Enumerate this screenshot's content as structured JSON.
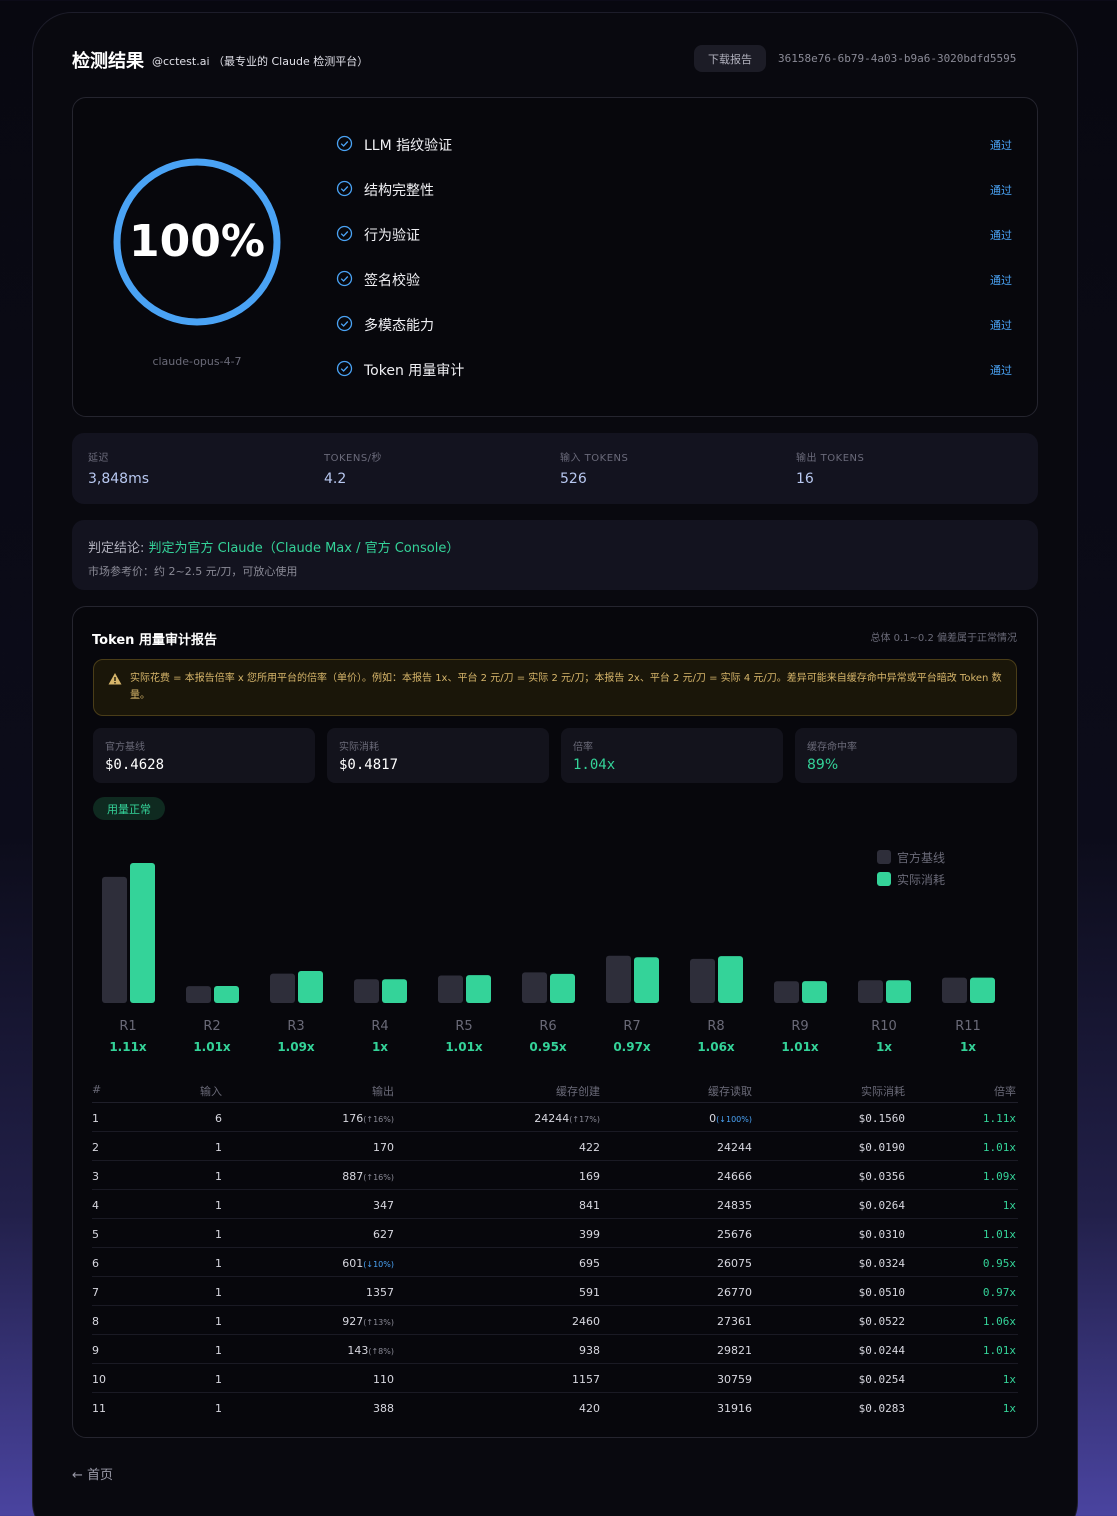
{
  "header": {
    "title": "检测结果",
    "subtitle": "@cctest.ai （最专业的 Claude 检测平台）",
    "download_label": "下载报告",
    "report_id": "36158e76-6b79-4a03-b9a6-3020bdfd5595"
  },
  "score": {
    "percent_text": "100%",
    "percent_value": 100,
    "model": "claude-opus-4-7",
    "ring_color": "#4aa3f5"
  },
  "checks": [
    {
      "label": "LLM 指纹验证",
      "status": "通过"
    },
    {
      "label": "结构完整性",
      "status": "通过"
    },
    {
      "label": "行为验证",
      "status": "通过"
    },
    {
      "label": "签名校验",
      "status": "通过"
    },
    {
      "label": "多模态能力",
      "status": "通过"
    },
    {
      "label": "Token 用量审计",
      "status": "通过"
    }
  ],
  "stats": [
    {
      "label": "延迟",
      "value": "3,848ms"
    },
    {
      "label": "TOKENS/秒",
      "value": "4.2"
    },
    {
      "label": "输入 TOKENS",
      "value": "526"
    },
    {
      "label": "输出 TOKENS",
      "value": "16"
    }
  ],
  "verdict": {
    "label": "判定结论: ",
    "value": "判定为官方 Claude（Claude Max / 官方 Console）",
    "price": "市场参考价：约 2~2.5 元/刀，可放心使用"
  },
  "audit": {
    "title": "Token 用量审计报告",
    "note": "总体 0.1~0.2 偏差属于正常情况",
    "warning": "实际花费 = 本报告倍率 x 您所用平台的倍率（单价）。例如：本报告 1x、平台 2 元/刀 = 实际 2 元/刀；本报告 2x、平台 2 元/刀 = 实际 4 元/刀。差异可能来自缓存命中异常或平台暗改 Token 数量。",
    "metrics": [
      {
        "label": "官方基线",
        "value": "$0.4628"
      },
      {
        "label": "实际消耗",
        "value": "$0.4817"
      },
      {
        "label": "倍率",
        "value": "1.04x"
      },
      {
        "label": "缓存命中率",
        "value": "89%"
      }
    ],
    "badge": "用量正常",
    "colors": {
      "baseline": "#2e2e3a",
      "actual": "#34d399"
    }
  },
  "chart_data": {
    "type": "bar",
    "categories": [
      "R1",
      "R2",
      "R3",
      "R4",
      "R5",
      "R6",
      "R7",
      "R8",
      "R9",
      "R10",
      "R11"
    ],
    "series": [
      {
        "name": "官方基线",
        "values": [
          0.1405,
          0.0188,
          0.0327,
          0.0264,
          0.0307,
          0.0341,
          0.0526,
          0.0492,
          0.0242,
          0.0254,
          0.0283
        ]
      },
      {
        "name": "实际消耗",
        "values": [
          0.156,
          0.019,
          0.0356,
          0.0264,
          0.031,
          0.0324,
          0.051,
          0.0522,
          0.0244,
          0.0254,
          0.0283
        ]
      }
    ],
    "ratio_labels": [
      "1.11x",
      "1.01x",
      "1.09x",
      "1x",
      "1.01x",
      "0.95x",
      "0.97x",
      "1.06x",
      "1.01x",
      "1x",
      "1x"
    ],
    "legend": "top-right",
    "grid": false
  },
  "table": {
    "headers": [
      "#",
      "输入",
      "输出",
      "缓存创建",
      "缓存读取",
      "实际消耗",
      "倍率"
    ],
    "rows": [
      {
        "n": "1",
        "in": "6",
        "out": "176",
        "out_chg": "(↑16%)",
        "out_dir": "up",
        "cc": "24244",
        "cc_chg": "(↑17%)",
        "cc_dir": "up",
        "cr": "0",
        "cr_chg": "(↓100%)",
        "cr_dir": "down",
        "cost": "$0.1560",
        "ratio": "1.11x"
      },
      {
        "n": "2",
        "in": "1",
        "out": "170",
        "out_chg": "",
        "out_dir": "",
        "cc": "422",
        "cc_chg": "",
        "cc_dir": "",
        "cr": "24244",
        "cr_chg": "",
        "cr_dir": "",
        "cost": "$0.0190",
        "ratio": "1.01x"
      },
      {
        "n": "3",
        "in": "1",
        "out": "887",
        "out_chg": "(↑16%)",
        "out_dir": "up",
        "cc": "169",
        "cc_chg": "",
        "cc_dir": "",
        "cr": "24666",
        "cr_chg": "",
        "cr_dir": "",
        "cost": "$0.0356",
        "ratio": "1.09x"
      },
      {
        "n": "4",
        "in": "1",
        "out": "347",
        "out_chg": "",
        "out_dir": "",
        "cc": "841",
        "cc_chg": "",
        "cc_dir": "",
        "cr": "24835",
        "cr_chg": "",
        "cr_dir": "",
        "cost": "$0.0264",
        "ratio": "1x"
      },
      {
        "n": "5",
        "in": "1",
        "out": "627",
        "out_chg": "",
        "out_dir": "",
        "cc": "399",
        "cc_chg": "",
        "cc_dir": "",
        "cr": "25676",
        "cr_chg": "",
        "cr_dir": "",
        "cost": "$0.0310",
        "ratio": "1.01x"
      },
      {
        "n": "6",
        "in": "1",
        "out": "601",
        "out_chg": "(↓10%)",
        "out_dir": "down",
        "cc": "695",
        "cc_chg": "",
        "cc_dir": "",
        "cr": "26075",
        "cr_chg": "",
        "cr_dir": "",
        "cost": "$0.0324",
        "ratio": "0.95x"
      },
      {
        "n": "7",
        "in": "1",
        "out": "1357",
        "out_chg": "",
        "out_dir": "",
        "cc": "591",
        "cc_chg": "",
        "cc_dir": "",
        "cr": "26770",
        "cr_chg": "",
        "cr_dir": "",
        "cost": "$0.0510",
        "ratio": "0.97x"
      },
      {
        "n": "8",
        "in": "1",
        "out": "927",
        "out_chg": "(↑13%)",
        "out_dir": "up",
        "cc": "2460",
        "cc_chg": "",
        "cc_dir": "",
        "cr": "27361",
        "cr_chg": "",
        "cr_dir": "",
        "cost": "$0.0522",
        "ratio": "1.06x"
      },
      {
        "n": "9",
        "in": "1",
        "out": "143",
        "out_chg": "(↑8%)",
        "out_dir": "up",
        "cc": "938",
        "cc_chg": "",
        "cc_dir": "",
        "cr": "29821",
        "cr_chg": "",
        "cr_dir": "",
        "cost": "$0.0244",
        "ratio": "1.01x"
      },
      {
        "n": "10",
        "in": "1",
        "out": "110",
        "out_chg": "",
        "out_dir": "",
        "cc": "1157",
        "cc_chg": "",
        "cc_dir": "",
        "cr": "30759",
        "cr_chg": "",
        "cr_dir": "",
        "cost": "$0.0254",
        "ratio": "1x"
      },
      {
        "n": "11",
        "in": "1",
        "out": "388",
        "out_chg": "",
        "out_dir": "",
        "cc": "420",
        "cc_chg": "",
        "cc_dir": "",
        "cr": "31916",
        "cr_chg": "",
        "cr_dir": "",
        "cost": "$0.0283",
        "ratio": "1x"
      }
    ]
  },
  "footer": {
    "back_label": "← 首页"
  }
}
